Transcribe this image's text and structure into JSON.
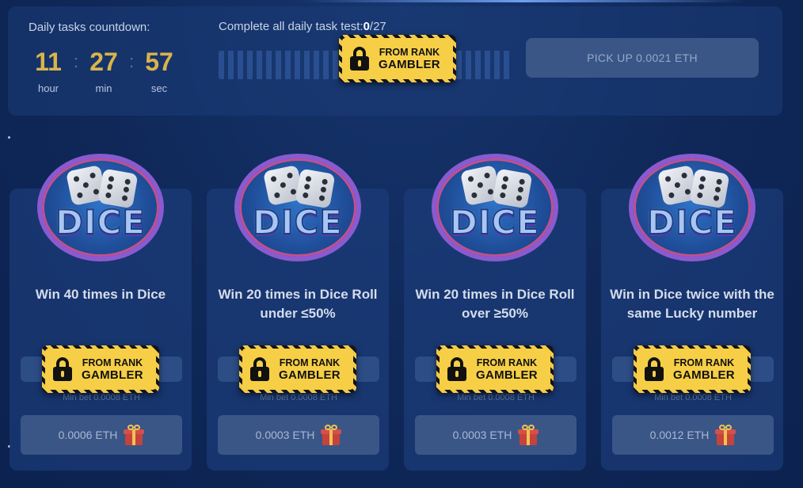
{
  "header": {
    "countdown_title": "Daily tasks countdown:",
    "timer": {
      "hours": "11",
      "hours_label": "hour",
      "minutes": "27",
      "minutes_label": "min",
      "seconds": "57",
      "seconds_label": "sec",
      "separator": ":"
    },
    "complete_prefix": "Complete all daily task test:",
    "complete_done": "0",
    "complete_total": "/27",
    "pickup_label": "PICK UP 0.0021 ETH"
  },
  "rank_badge": {
    "line1": "FROM RANK",
    "line2": "GAMBLER"
  },
  "logo_text": "DICE",
  "cards": [
    {
      "title": "Win 40 times in Dice",
      "min_bet": "Min bet 0.0008 ETH",
      "reward": "0.0006 ETH"
    },
    {
      "title": "Win 20 times in Dice Roll under ≤50%",
      "min_bet": "Min bet 0.0008 ETH",
      "reward": "0.0003 ETH"
    },
    {
      "title": "Win 20 times in Dice Roll over ≥50%",
      "min_bet": "Min bet 0.0008 ETH",
      "reward": "0.0003 ETH"
    },
    {
      "title": "Win in Dice twice with the same Lucky number",
      "min_bet": "Min bet 0.0008 ETH",
      "reward": "0.0012 ETH"
    }
  ],
  "icons": {
    "lock": "lock-icon",
    "gift": "gift-icon"
  },
  "colors": {
    "accent_gold": "#d9b44a",
    "badge_yellow": "#f6cf46",
    "background": "#0f2858"
  }
}
